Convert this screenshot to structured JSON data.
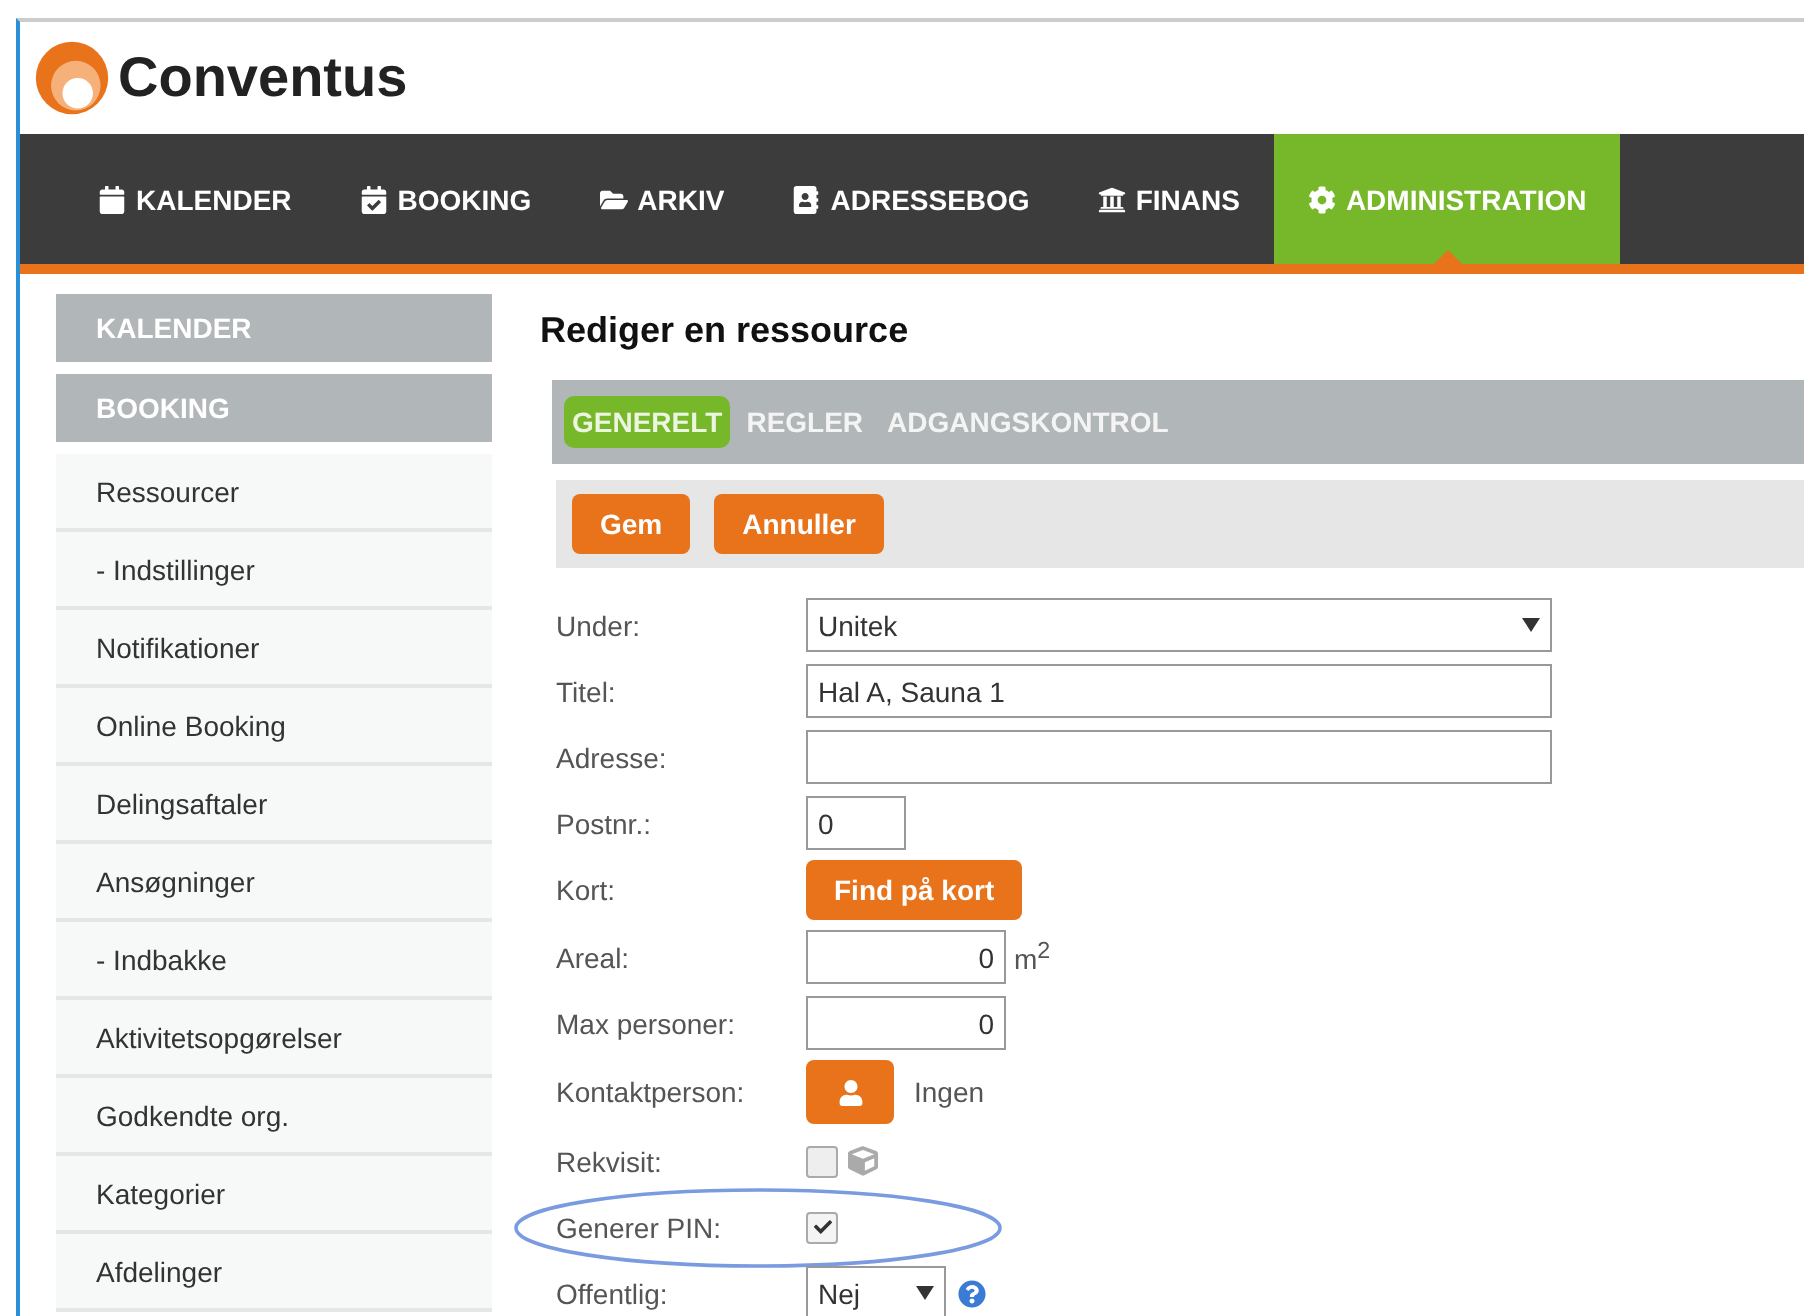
{
  "logo": {
    "text": "Conventus"
  },
  "nav": [
    {
      "label": "KALENDER",
      "selected": false
    },
    {
      "label": "BOOKING",
      "selected": false
    },
    {
      "label": "ARKIV",
      "selected": false
    },
    {
      "label": "ADRESSEBOG",
      "selected": false
    },
    {
      "label": "FINANS",
      "selected": false
    },
    {
      "label": "ADMINISTRATION",
      "selected": true
    }
  ],
  "sidebar": {
    "sections": [
      {
        "label": "KALENDER"
      },
      {
        "label": "BOOKING",
        "items": [
          "Ressourcer",
          "- Indstillinger",
          "Notifikationer",
          "Online Booking",
          "Delingsaftaler",
          "Ansøgninger",
          "- Indbakke",
          "Aktivitetsopgørelser",
          "Godkendte org.",
          "Kategorier",
          "Afdelinger"
        ]
      }
    ]
  },
  "page_title": "Rediger en ressource",
  "tabs": [
    {
      "label": "GENERELT",
      "selected": true
    },
    {
      "label": "REGLER",
      "selected": false
    },
    {
      "label": "ADGANGSKONTROL",
      "selected": false
    }
  ],
  "actions": [
    "Gem",
    "Annuller"
  ],
  "fields": [
    {
      "kind": "select",
      "label": "Under:",
      "value": "Unitek"
    },
    {
      "kind": "text",
      "label": "Titel:",
      "value": "Hal A, Sauna 1"
    },
    {
      "kind": "text",
      "label": "Adresse:"
    },
    {
      "kind": "short",
      "label": "Postnr.:",
      "value": "0"
    },
    {
      "kind": "button",
      "label": "Kort:",
      "value": "Find på kort"
    },
    {
      "kind": "number",
      "label": "Areal:",
      "value": "0",
      "unit": "m$^{2}$"
    },
    {
      "kind": "number",
      "label": "Max personer:",
      "value": "0"
    },
    {
      "kind": "contact",
      "label": "Kontaktperson:",
      "value": "Ingen"
    },
    {
      "kind": "checkbox",
      "label": "Rekvisit:",
      "checked": false,
      "cube": true
    },
    {
      "kind": "checkbox",
      "label": "Generer PIN:",
      "checked": true,
      "highlighted": true
    },
    {
      "kind": "smallselect",
      "label": "Offentlig:",
      "value": "Nej",
      "help": true
    }
  ]
}
